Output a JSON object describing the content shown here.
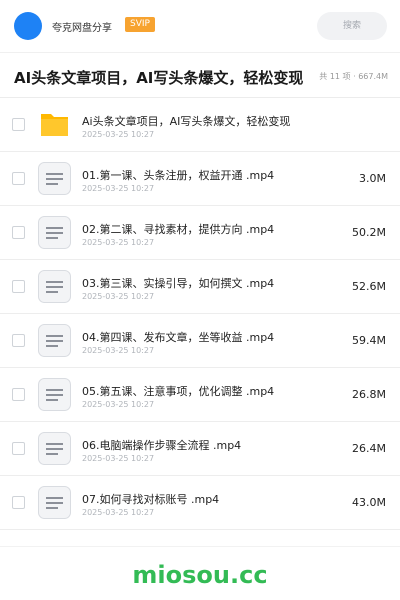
{
  "header": {
    "brand": "夸克网盘分享",
    "badge": "SVIP",
    "search_placeholder": "搜索",
    "avatar_color": "#1e82f5"
  },
  "share": {
    "title": "AI头条文章项目，AI写头条爆文，轻松变现",
    "summary": "共 11 项 · 667.4M"
  },
  "items": [
    {
      "type": "folder",
      "icon": "folder-icon",
      "name": "Ai头条文章项目，AI写头条爆文，轻松变现",
      "date": "2025-03-25 10:27",
      "size": ""
    },
    {
      "type": "file",
      "icon": "file-icon",
      "name": "01.第一课、头条注册，权益开通 .mp4",
      "date": "2025-03-25 10:27",
      "size": "3.0M"
    },
    {
      "type": "file",
      "icon": "file-icon",
      "name": "02.第二课、寻找素材，提供方向 .mp4",
      "date": "2025-03-25 10:27",
      "size": "50.2M"
    },
    {
      "type": "file",
      "icon": "file-icon",
      "name": "03.第三课、实操引导，如何撰文 .mp4",
      "date": "2025-03-25 10:27",
      "size": "52.6M"
    },
    {
      "type": "file",
      "icon": "file-icon",
      "name": "04.第四课、发布文章，坐等收益 .mp4",
      "date": "2025-03-25 10:27",
      "size": "59.4M"
    },
    {
      "type": "file",
      "icon": "file-icon",
      "name": "05.第五课、注意事项，优化调整 .mp4",
      "date": "2025-03-25 10:27",
      "size": "26.8M"
    },
    {
      "type": "file",
      "icon": "file-icon",
      "name": "06.电脑端操作步骤全流程 .mp4",
      "date": "2025-03-25 10:27",
      "size": "26.4M"
    },
    {
      "type": "file",
      "icon": "file-icon",
      "name": "07.如何寻找对标账号 .mp4",
      "date": "2025-03-25 10:27",
      "size": "43.0M"
    }
  ],
  "watermark": "miosou.cc",
  "colors": {
    "accent": "#f7a330",
    "watermark": "#33bb55",
    "folder": "#ffc72c"
  }
}
